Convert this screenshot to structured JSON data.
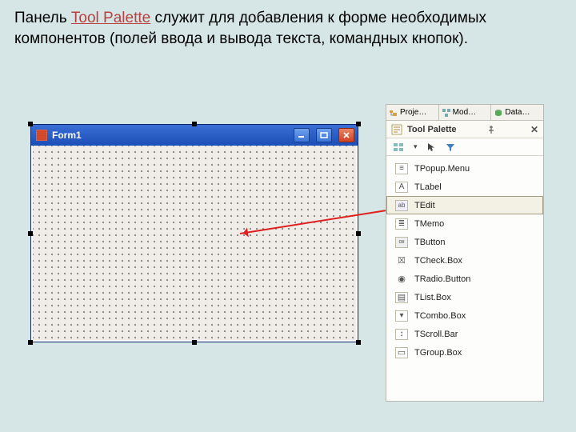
{
  "caption": {
    "pre": "Панель ",
    "hl": "Tool Palette",
    "post": " служит для добавления  к форме необходимых компонентов (полей ввода и вывода текста, командных кнопок)."
  },
  "form": {
    "title": "Form1"
  },
  "panel": {
    "tabs": [
      {
        "label": "Proje…",
        "icon": "project-tree-icon"
      },
      {
        "label": "Mod…",
        "icon": "model-icon"
      },
      {
        "label": "Data…",
        "icon": "data-icon"
      }
    ],
    "header": {
      "title": "Tool Palette"
    },
    "items": [
      {
        "label": "TPopup.Menu",
        "icon": "menu",
        "selected": false
      },
      {
        "label": "TLabel",
        "icon": "label",
        "selected": false
      },
      {
        "label": "TEdit",
        "icon": "edit",
        "selected": true
      },
      {
        "label": "TMemo",
        "icon": "memo",
        "selected": false
      },
      {
        "label": "TButton",
        "icon": "button",
        "selected": false
      },
      {
        "label": "TCheck.Box",
        "icon": "check",
        "selected": false
      },
      {
        "label": "TRadio.Button",
        "icon": "radio",
        "selected": false
      },
      {
        "label": "TList.Box",
        "icon": "list",
        "selected": false
      },
      {
        "label": "TCombo.Box",
        "icon": "combo",
        "selected": false
      },
      {
        "label": "TScroll.Bar",
        "icon": "scroll",
        "selected": false
      },
      {
        "label": "TGroup.Box",
        "icon": "group",
        "selected": false
      }
    ]
  }
}
